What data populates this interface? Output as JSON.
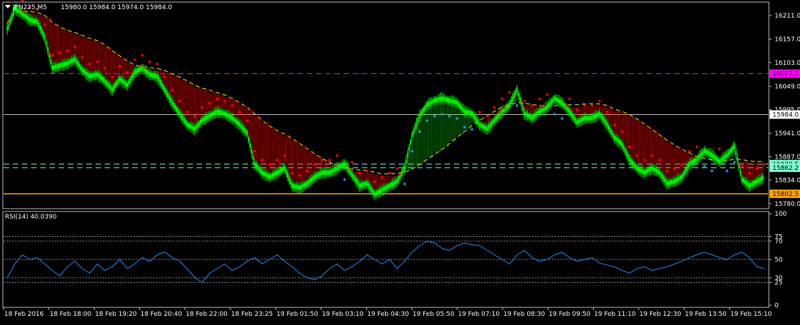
{
  "header": {
    "symbol_tf": "JPN225,M5",
    "ohlc": "15980.0 15984.0 15974.0 15984.0"
  },
  "colors": {
    "background": "#000000",
    "bull": "#00FF00",
    "bear": "#FF0000",
    "ma": "#FFFF00",
    "psar_up": "#1E90FF",
    "psar_down": "#FF0000",
    "magenta_line": "#FF00FF",
    "orange_line": "#FFA500",
    "cyan_line": "#7FFFD4",
    "rsi": "#1E90FF"
  },
  "chart_data": [
    {
      "type": "line",
      "x": [
        "18 Feb 2016",
        "18 Feb 18:00",
        "18 Feb 19:20",
        "18 Feb 20:40",
        "18 Feb 22:00",
        "18 Feb 23:25",
        "19 Feb 01:50",
        "19 Feb 03:10",
        "19 Feb 04:30",
        "19 Feb 05:50",
        "19 Feb 07:10",
        "19 Feb 08:30",
        "19 Feb 09:50",
        "19 Feb 11:10",
        "19 Feb 12:30",
        "19 Feb 13:50",
        "19 Feb 15:10"
      ],
      "y_ticks": [
        "16211.0",
        "16157.0",
        "16103.0",
        "16049.0",
        "15995.0",
        "15941.0",
        "15887.0",
        "15834.0",
        "15780.0"
      ],
      "ylim": [
        15770,
        16240
      ],
      "series": [
        {
          "values": [
            16180,
            16225,
            16215,
            16200,
            16195,
            16160,
            16090,
            16095,
            16100,
            16110,
            16085,
            16070,
            16075,
            16060,
            16040,
            16065,
            16050,
            16080,
            16090,
            16075,
            16070,
            16040,
            16010,
            15985,
            15960,
            15950,
            15970,
            15980,
            15990,
            15985,
            15975,
            15960,
            15940,
            15870,
            15850,
            15840,
            15850,
            15860,
            15820,
            15815,
            15825,
            15840,
            15850,
            15850,
            15860,
            15870,
            15845,
            15820,
            15825,
            15800,
            15810,
            15820,
            15830,
            15860,
            15935,
            15980,
            16005,
            16015,
            16020,
            16015,
            16010,
            15990,
            15985,
            15960,
            15950,
            15970,
            15990,
            16005,
            16040,
            15985,
            15975,
            15990,
            16000,
            16020,
            16010,
            15990,
            15965,
            15975,
            15975,
            15985,
            15960,
            15930,
            15915,
            15880,
            15860,
            15850,
            15860,
            15850,
            15825,
            15830,
            15840,
            15870,
            15880,
            15900,
            15890,
            15875,
            15890,
            15910,
            15835,
            15820,
            15830,
            15840
          ]
        }
      ],
      "levels": [
        {
          "name": "magenta",
          "value": 16077.7,
          "label": "16077.7"
        },
        {
          "name": "price",
          "value": 15984.0,
          "label": "15984.0"
        },
        {
          "name": "cyan-upper",
          "value": 15870.5,
          "label": "15870.5"
        },
        {
          "name": "cyan-lower",
          "value": 15862.2,
          "label": "15862.2"
        },
        {
          "name": "orange",
          "value": 15802.5,
          "label": "15802.5"
        }
      ]
    },
    {
      "type": "line",
      "title": "RSI(14) 40.0390",
      "y_ticks": [
        "100",
        "75",
        "70",
        "50",
        "30",
        "25",
        "0"
      ],
      "ylim": [
        0,
        100
      ],
      "series": [
        {
          "values": [
            30,
            45,
            55,
            50,
            52,
            45,
            38,
            32,
            42,
            48,
            40,
            35,
            45,
            38,
            42,
            50,
            40,
            45,
            52,
            48,
            55,
            58,
            52,
            48,
            40,
            30,
            25,
            35,
            40,
            45,
            38,
            42,
            48,
            52,
            45,
            50,
            55,
            48,
            42,
            35,
            30,
            28,
            32,
            40,
            45,
            38,
            42,
            48,
            55,
            50,
            45,
            50,
            40,
            48,
            58,
            65,
            70,
            68,
            62,
            60,
            65,
            68,
            66,
            65,
            60,
            55,
            50,
            45,
            55,
            60,
            52,
            48,
            50,
            55,
            58,
            52,
            48,
            50,
            52,
            46,
            44,
            42,
            38,
            35,
            40,
            42,
            38,
            40,
            42,
            45,
            48,
            52,
            55,
            58,
            55,
            52,
            50,
            55,
            58,
            52,
            42,
            40
          ]
        }
      ]
    }
  ]
}
